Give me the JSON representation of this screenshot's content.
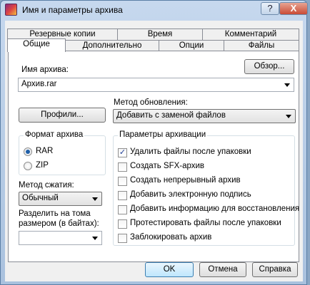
{
  "window": {
    "title": "Имя и параметры архива"
  },
  "titlebar": {
    "help": "?",
    "close": "X"
  },
  "tabs_back": [
    "Резервные копии",
    "Время",
    "Комментарий"
  ],
  "tabs_front": [
    "Общие",
    "Дополнительно",
    "Опции",
    "Файлы"
  ],
  "archive_name": {
    "label": "Имя архива:",
    "value": "Архив.rar",
    "browse": "Обзор..."
  },
  "update_method": {
    "label": "Метод обновления:",
    "value": "Добавить с заменой файлов"
  },
  "profiles_button": "Профили...",
  "format": {
    "title": "Формат архива",
    "options": [
      "RAR",
      "ZIP"
    ],
    "selected": "RAR"
  },
  "compression": {
    "label": "Метод сжатия:",
    "value": "Обычный"
  },
  "split": {
    "label_line1": "Разделить на тома",
    "label_line2": "размером (в байтах):",
    "value": ""
  },
  "options": {
    "title": "Параметры архивации",
    "items": [
      {
        "label": "Удалить файлы после упаковки",
        "checked": true
      },
      {
        "label": "Создать SFX-архив",
        "checked": false
      },
      {
        "label": "Создать непрерывный архив",
        "checked": false
      },
      {
        "label": "Добавить электронную подпись",
        "checked": false
      },
      {
        "label": "Добавить информацию для восстановления",
        "checked": false
      },
      {
        "label": "Протестировать файлы после упаковки",
        "checked": false
      },
      {
        "label": "Заблокировать архив",
        "checked": false
      }
    ]
  },
  "buttons": {
    "ok": "OK",
    "cancel": "Отмена",
    "help": "Справка"
  }
}
